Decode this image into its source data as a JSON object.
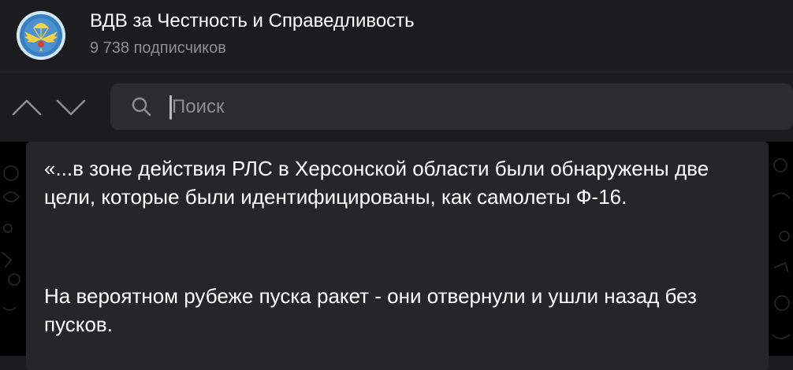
{
  "channel": {
    "title": "ВДВ за Честность и Справедливость",
    "subscribers": "9 738 подписчиков"
  },
  "search": {
    "placeholder": "Поиск"
  },
  "nav": {
    "up_icon": "chevron-up-icon",
    "down_icon": "chevron-down-icon"
  },
  "message": {
    "paragraphs": [
      "«...в зоне действия РЛС в Херсонской области были обнаружены две цели, которые были идентифицированы, как самолеты Ф-16.",
      "На вероятном рубеже пуска ракет - они отвернули и ушли назад без пусков."
    ]
  },
  "colors": {
    "background": "#1c1c1e",
    "search_field": "#2c2c2e",
    "bubble": "#262628",
    "secondary_text": "#8d8d93"
  }
}
